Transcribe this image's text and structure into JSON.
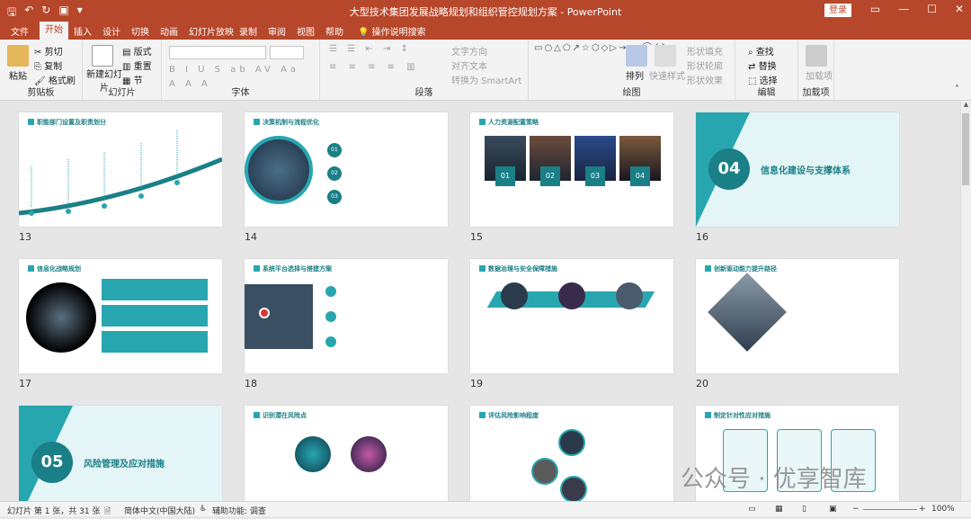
{
  "window": {
    "title": "大型技术集团发展战略规划和组织管控规划方案 - PowerPoint",
    "login": "登录"
  },
  "tabs": [
    "文件",
    "开始",
    "插入",
    "设计",
    "切换",
    "动画",
    "幻灯片放映",
    "录制",
    "审阅",
    "视图",
    "帮助",
    "操作说明搜索"
  ],
  "ribbon": {
    "clipboard": {
      "paste": "粘贴",
      "cut": "剪切",
      "copy": "复制",
      "format_painter": "格式刷",
      "label": "剪贴板"
    },
    "slides": {
      "new_slide": "新建幻灯片",
      "layout": "版式",
      "reset": "重置",
      "section": "节",
      "label": "幻灯片"
    },
    "font": {
      "label": "字体"
    },
    "paragraph": {
      "text_direction": "文字方向",
      "align_text": "对齐文本",
      "smartart": "转换为 SmartArt",
      "label": "段落"
    },
    "drawing": {
      "arrange": "排列",
      "quick_styles": "快速样式",
      "shape_fill": "形状填充",
      "shape_outline": "形状轮廓",
      "shape_effects": "形状效果",
      "label": "绘图"
    },
    "editing": {
      "find": "查找",
      "replace": "替换",
      "select": "选择",
      "label": "编辑"
    },
    "addins": {
      "add": "加载项",
      "label": "加载项"
    }
  },
  "slides": [
    {
      "num": "13",
      "title": "职能部门设置及职责划分"
    },
    {
      "num": "14",
      "title": "决策机制与流程优化"
    },
    {
      "num": "15",
      "title": "人力资源配置策略",
      "items": [
        "01",
        "02",
        "03",
        "04"
      ]
    },
    {
      "num": "16",
      "section": "04",
      "title": "信息化建设与支撑体系"
    },
    {
      "num": "17",
      "title": "信息化战略规划"
    },
    {
      "num": "18",
      "title": "系统平台选择与搭建方案"
    },
    {
      "num": "19",
      "title": "数据治理与安全保障措施"
    },
    {
      "num": "20",
      "title": "创新驱动能力提升路径"
    },
    {
      "num": "",
      "section": "05",
      "title": "风险管理及应对措施"
    },
    {
      "num": "",
      "title": "识别潜在风险点"
    },
    {
      "num": "",
      "title": "评估风险影响程度"
    },
    {
      "num": "",
      "title": "制定针对性应对措施"
    }
  ],
  "status": {
    "slide_info": "幻灯片 第 1 张，共 31 张",
    "language": "简体中文(中国大陆)",
    "accessibility": "辅助功能: 调查",
    "zoom": "100%"
  },
  "watermark": "公众号 · 优享智库"
}
